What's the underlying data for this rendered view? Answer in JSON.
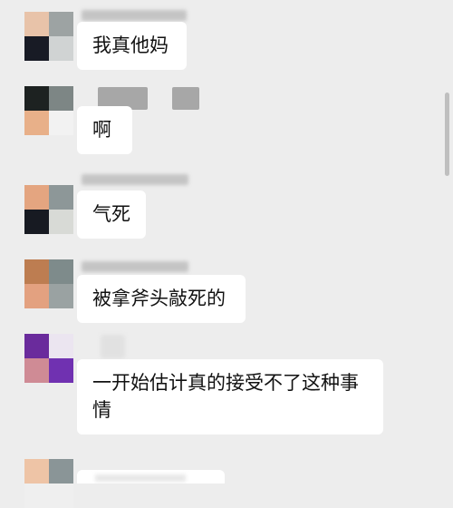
{
  "messages": [
    {
      "text": "我真他妈",
      "avatar_colors": [
        "#e8c3a9",
        "#9da3a3",
        "#181b25",
        "#d0d3d3"
      ]
    },
    {
      "text": "啊",
      "avatar_colors": [
        "#1d2221",
        "#7d8685",
        "#e8b089",
        "#f2f2f2"
      ]
    },
    {
      "text": "气死",
      "avatar_colors": [
        "#e4a580",
        "#8d9798",
        "#171a22",
        "#d8dad6"
      ]
    },
    {
      "text": "被拿斧头敲死的",
      "avatar_colors": [
        "#bd7d51",
        "#7e8b8b",
        "#e3a180",
        "#9aa2a2"
      ]
    },
    {
      "text": "一开始估计真的接受不了这种事情",
      "avatar_colors": [
        "#6a2b9c",
        "#ebe5f0",
        "#cf8b95",
        "#7031b1"
      ]
    },
    {
      "text": "",
      "avatar_colors": [
        "#eec4a6",
        "#8a9597",
        "#efefef",
        "#efefef"
      ]
    }
  ],
  "colors": {
    "background": "#ededed",
    "bubble": "#ffffff",
    "text": "#111111",
    "redaction": "#b7b7b7"
  }
}
